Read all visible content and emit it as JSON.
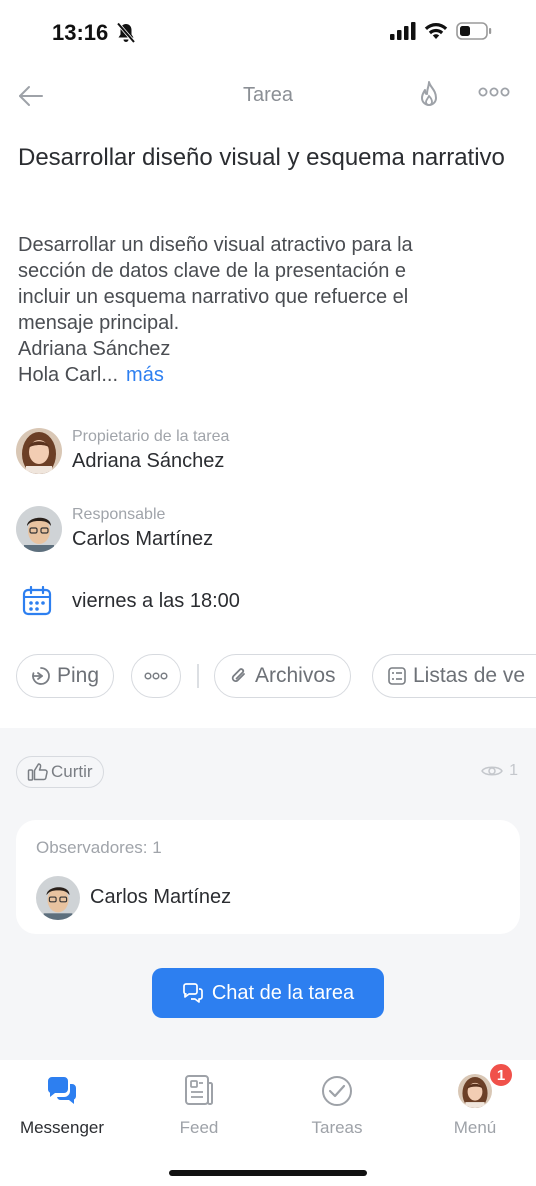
{
  "status_bar": {
    "time": "13:16"
  },
  "nav": {
    "title": "Tarea",
    "back_icon": "back-arrow-icon",
    "fire_icon": "flame-icon",
    "more_icon": "more-icon"
  },
  "task": {
    "title": "Desarrollar diseño visual y esquema narrativo",
    "description_lines": [
      "Desarrollar un diseño visual atractivo para la",
      "sección de datos clave de la presentación e",
      "incluir un esquema narrativo que refuerce el",
      "mensaje principal.",
      "Adriana Sánchez",
      "Hola Carl..."
    ],
    "more_link": "más"
  },
  "owner": {
    "label": "Propietario de la tarea",
    "name": "Adriana Sánchez"
  },
  "responsible": {
    "label": "Responsable",
    "name": "Carlos Martínez"
  },
  "deadline": {
    "text": "viernes a las 18:00"
  },
  "actions": {
    "ping": "Ping",
    "files": "Archivos",
    "checklists": "Listas de ve"
  },
  "social": {
    "like": "Curtir",
    "views": "1"
  },
  "observers": {
    "title": "Observadores: 1",
    "name": "Carlos Martínez"
  },
  "chat_button": "Chat de la tarea",
  "tabbar": {
    "messenger": "Messenger",
    "feed": "Feed",
    "tasks": "Tareas",
    "menu": "Menú",
    "menu_badge": "1"
  },
  "colors": {
    "accent": "#2d7ff0",
    "badge": "#f0514a",
    "muted": "#a0a4aa"
  }
}
